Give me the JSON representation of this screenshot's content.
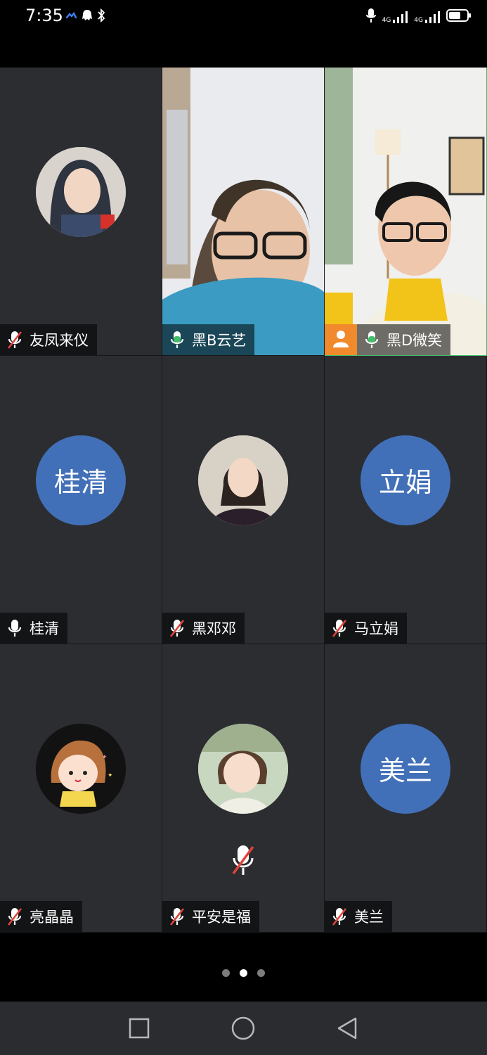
{
  "status_bar": {
    "time": "7:35",
    "left_icons": [
      "cloud-icon",
      "ghost-icon",
      "bluetooth-icon"
    ],
    "right_icons": [
      "mic-icon",
      "signal-4g-icon",
      "signal-4g-icon",
      "battery-icon"
    ],
    "net_label_1": "4G",
    "net_label_2": "4G"
  },
  "participants": [
    {
      "name": "友凤来仪",
      "mic": "muted",
      "display": "photo-avatar"
    },
    {
      "name": "黑B云艺",
      "mic": "active",
      "display": "video"
    },
    {
      "name": "黑D微笑",
      "mic": "active",
      "display": "video",
      "active_speaker": true,
      "host_badge": "person-icon"
    },
    {
      "name": "桂清",
      "mic": "on",
      "display": "initials",
      "initials": "桂清"
    },
    {
      "name": "黑邓邓",
      "mic": "muted",
      "display": "photo-avatar"
    },
    {
      "name": "马立娟",
      "mic": "muted",
      "display": "initials",
      "initials": "立娟"
    },
    {
      "name": "亮晶晶",
      "mic": "muted",
      "display": "cartoon-avatar"
    },
    {
      "name": "平安是福",
      "mic": "muted",
      "display": "photo-avatar",
      "center_mic": "muted"
    },
    {
      "name": "美兰",
      "mic": "muted",
      "display": "initials",
      "initials": "美兰"
    }
  ],
  "pager": {
    "count": 3,
    "current": 2
  },
  "nav_bar": {
    "buttons": [
      "recents-button",
      "home-button",
      "back-button"
    ]
  },
  "colors": {
    "accent_green": "#3fbf6a",
    "avatar_blue": "#4270b8",
    "host_orange": "#f08a2c",
    "mute_red": "#e0443b"
  }
}
